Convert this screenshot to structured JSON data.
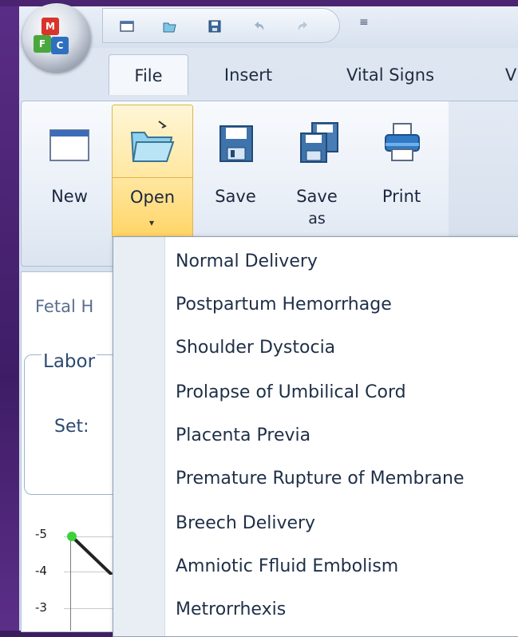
{
  "quick_access": {
    "icons": [
      "window-icon",
      "open-folder-icon",
      "save-icon",
      "undo-icon",
      "redo-icon"
    ],
    "more_glyph": "≡"
  },
  "orb": {
    "letters": [
      "M",
      "F",
      "C"
    ]
  },
  "tabs": [
    {
      "label": "File",
      "active": true
    },
    {
      "label": "Insert",
      "active": false
    },
    {
      "label": "Vital Signs",
      "active": false
    },
    {
      "label": "V",
      "active": false
    }
  ],
  "ribbon": {
    "buttons": [
      {
        "id": "new",
        "label": "New"
      },
      {
        "id": "open",
        "label": "Open",
        "selected": true
      },
      {
        "id": "save",
        "label": "Save"
      },
      {
        "id": "save_as",
        "label_line1": "Save",
        "label_line2": "as"
      },
      {
        "id": "print",
        "label": "Print"
      }
    ]
  },
  "content": {
    "fetal_title": "Fetal H",
    "labor_title": "Labor",
    "set_label": "Set:",
    "axis": [
      "-5",
      "-4",
      "-3"
    ]
  },
  "menu": {
    "items": [
      "Normal Delivery",
      "Postpartum Hemorrhage",
      "Shoulder Dystocia",
      "Prolapse of Umbilical Cord",
      "Placenta Previa",
      "Premature Rupture of Membrane",
      "Breech Delivery",
      "Amniotic Ffluid Embolism",
      "Metrorrhexis"
    ]
  },
  "colors": {
    "desktop": "#4a2470",
    "accent_hover": "#ffd465",
    "text_primary": "#1f2f47",
    "chart_point": "#3cd23c"
  }
}
